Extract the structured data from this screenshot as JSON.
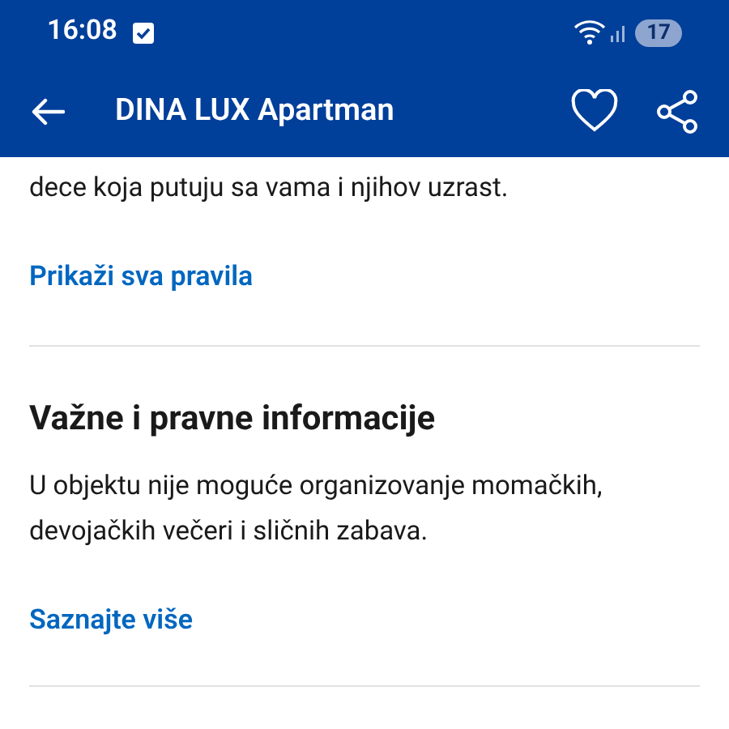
{
  "status_bar": {
    "time": "16:08",
    "battery": "17"
  },
  "header": {
    "title": "DINA LUX Apartman"
  },
  "sections": [
    {
      "kind": "tail",
      "text": "dece koja putuju sa vama i njihov uzrast.",
      "link": "Prikaži sva pravila"
    },
    {
      "kind": "full",
      "heading": "Važne i pravne informacije",
      "text": "U objektu nije moguće organizovanje momačkih, devojačkih večeri i sličnih zabava.",
      "link": "Saznajte više"
    }
  ]
}
